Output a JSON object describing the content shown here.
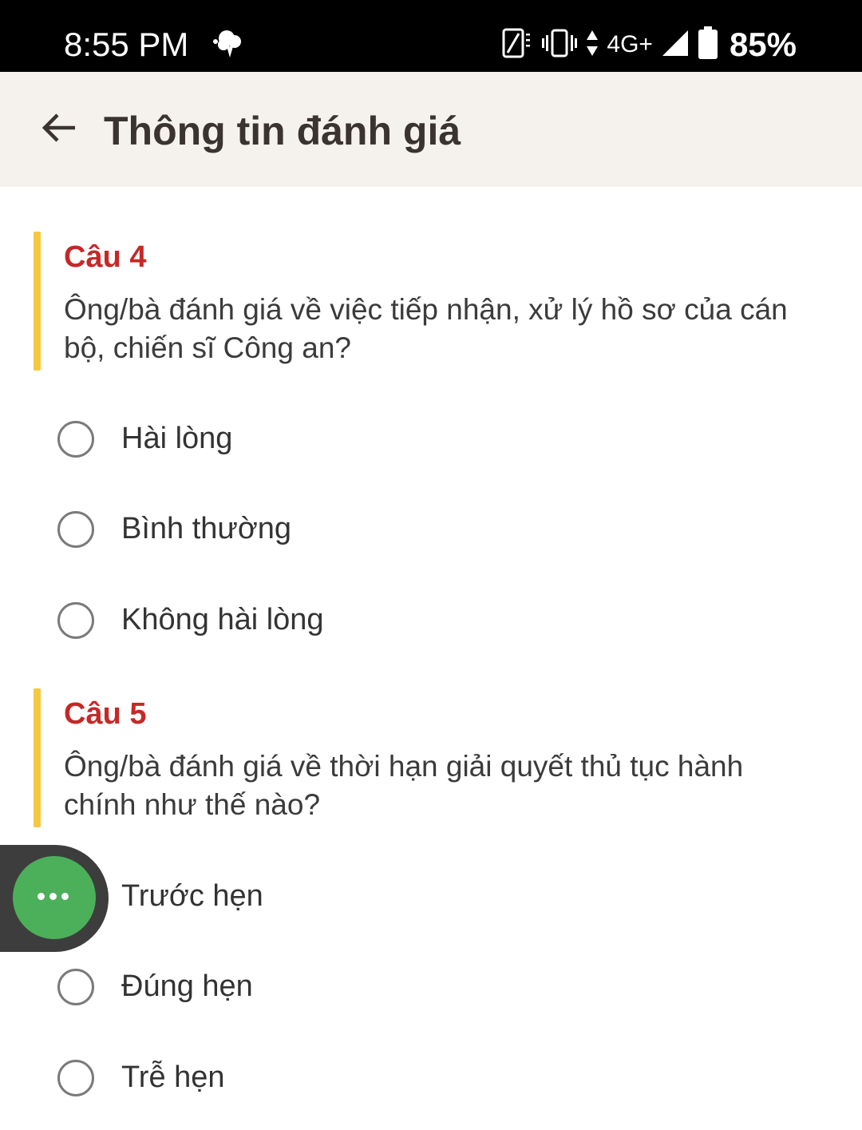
{
  "status_bar": {
    "time": "8:55 PM",
    "network": "4G+",
    "battery": "85%",
    "icons": [
      "notification-icon",
      "battery-saver-icon",
      "vibrate-icon",
      "data-arrows-icon",
      "signal-icon",
      "battery-icon"
    ]
  },
  "app_bar": {
    "title": "Thông tin đánh giá",
    "back_icon": "arrow-left-icon"
  },
  "questions": [
    {
      "number": "Câu 4",
      "text": "Ông/bà đánh giá về việc tiếp nhận, xử lý hồ sơ của cán bộ, chiến sĩ Công an?",
      "options": [
        "Hài lòng",
        "Bình thường",
        "Không hài lòng"
      ]
    },
    {
      "number": "Câu 5",
      "text": "Ông/bà đánh giá về thời hạn giải quyết thủ tục hành chính như thế nào?",
      "options": [
        "Trước hẹn",
        "Đúng hẹn",
        "Trễ hẹn"
      ]
    }
  ],
  "colors": {
    "accent_bar": "#f5c842",
    "question_number": "#c62828",
    "app_bar_bg": "#f5f1ec",
    "fab": "#4caf5a"
  },
  "fab": {
    "icon": "more-dots-icon"
  }
}
